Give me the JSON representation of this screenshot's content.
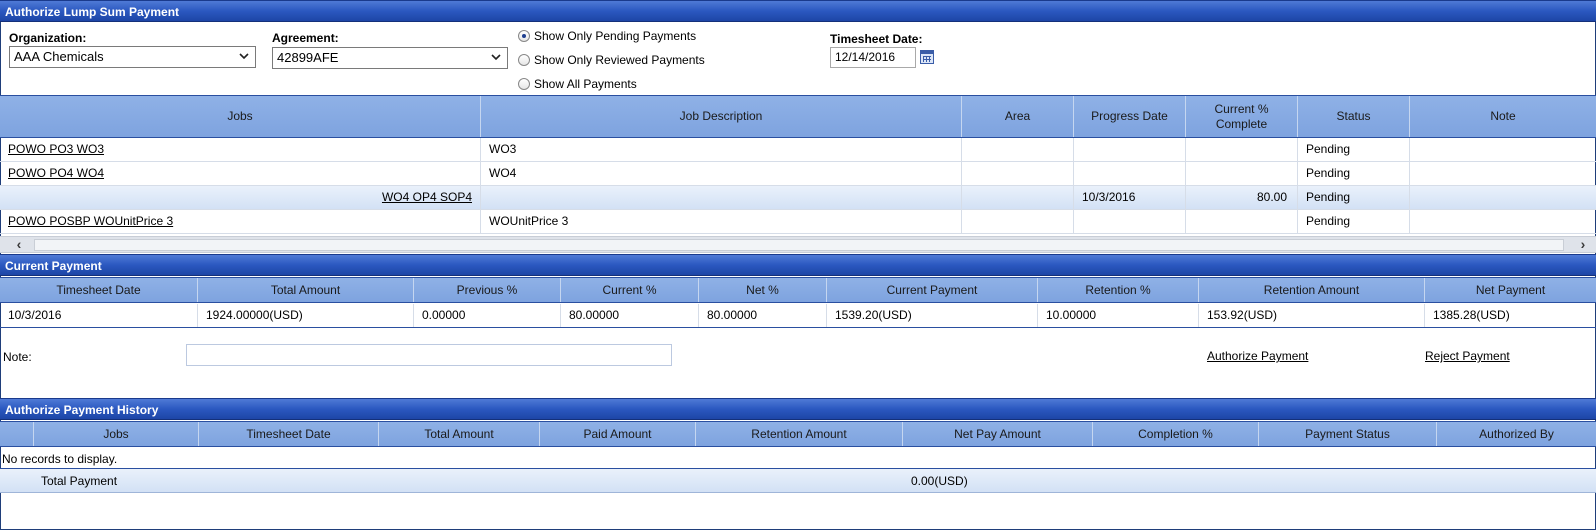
{
  "authorize": {
    "title": "Authorize Lump Sum Payment",
    "organization_label": "Organization:",
    "organization_value": "AAA Chemicals",
    "agreement_label": "Agreement:",
    "agreement_value": "42899AFE",
    "filters": [
      {
        "label": "Show Only Pending Payments",
        "selected": true
      },
      {
        "label": "Show Only Reviewed Payments",
        "selected": false
      },
      {
        "label": "Show All Payments",
        "selected": false
      }
    ],
    "timesheet_label": "Timesheet Date:",
    "timesheet_value": "12/14/2016"
  },
  "jobs_grid": {
    "columns": [
      "Jobs",
      "Job Description",
      "Area",
      "Progress Date",
      "Current % Complete",
      "Status",
      "Note"
    ],
    "rows": [
      {
        "job": "POWO PO3 WO3",
        "description": "WO3",
        "area": "",
        "progress_date": "",
        "current_pct": "",
        "status": "Pending",
        "note": ""
      },
      {
        "job": "POWO PO4 WO4",
        "description": "WO4",
        "area": "",
        "progress_date": "",
        "current_pct": "",
        "status": "Pending",
        "note": ""
      },
      {
        "job": "WO4 OP4 SOP4",
        "description": "",
        "area": "",
        "progress_date": "10/3/2016",
        "current_pct": "80.00",
        "status": "Pending",
        "note": ""
      },
      {
        "job": "POWO POSBP WOUnitPrice 3",
        "description": "WOUnitPrice 3",
        "area": "",
        "progress_date": "",
        "current_pct": "",
        "status": "Pending",
        "note": ""
      }
    ]
  },
  "current_payment": {
    "title": "Current Payment",
    "columns": [
      "Timesheet Date",
      "Total Amount",
      "Previous %",
      "Current %",
      "Net %",
      "Current Payment",
      "Retention %",
      "Retention Amount",
      "Net Payment"
    ],
    "row": [
      "10/3/2016",
      "1924.00000(USD)",
      "0.00000",
      "80.00000",
      "80.00000",
      "1539.20(USD)",
      "10.00000",
      "153.92(USD)",
      "1385.28(USD)"
    ],
    "note_label": "Note:",
    "authorize_link": "Authorize Payment",
    "reject_link": "Reject Payment"
  },
  "history": {
    "title": "Authorize Payment History",
    "columns": [
      "",
      "Jobs",
      "Timesheet Date",
      "Total Amount",
      "Paid Amount",
      "Retention Amount",
      "Net Pay Amount",
      "Completion %",
      "Payment Status",
      "Authorized By"
    ],
    "empty_text": "No records to display.",
    "total_label": "Total Payment",
    "total_value": "0.00(USD)"
  },
  "colors": {
    "header_blue": "#2b58c0",
    "grid_header": "#8fb1e6"
  },
  "icons": [
    "chevron-down-icon",
    "calendar-icon",
    "scroll-left-icon",
    "scroll-right-icon"
  ]
}
